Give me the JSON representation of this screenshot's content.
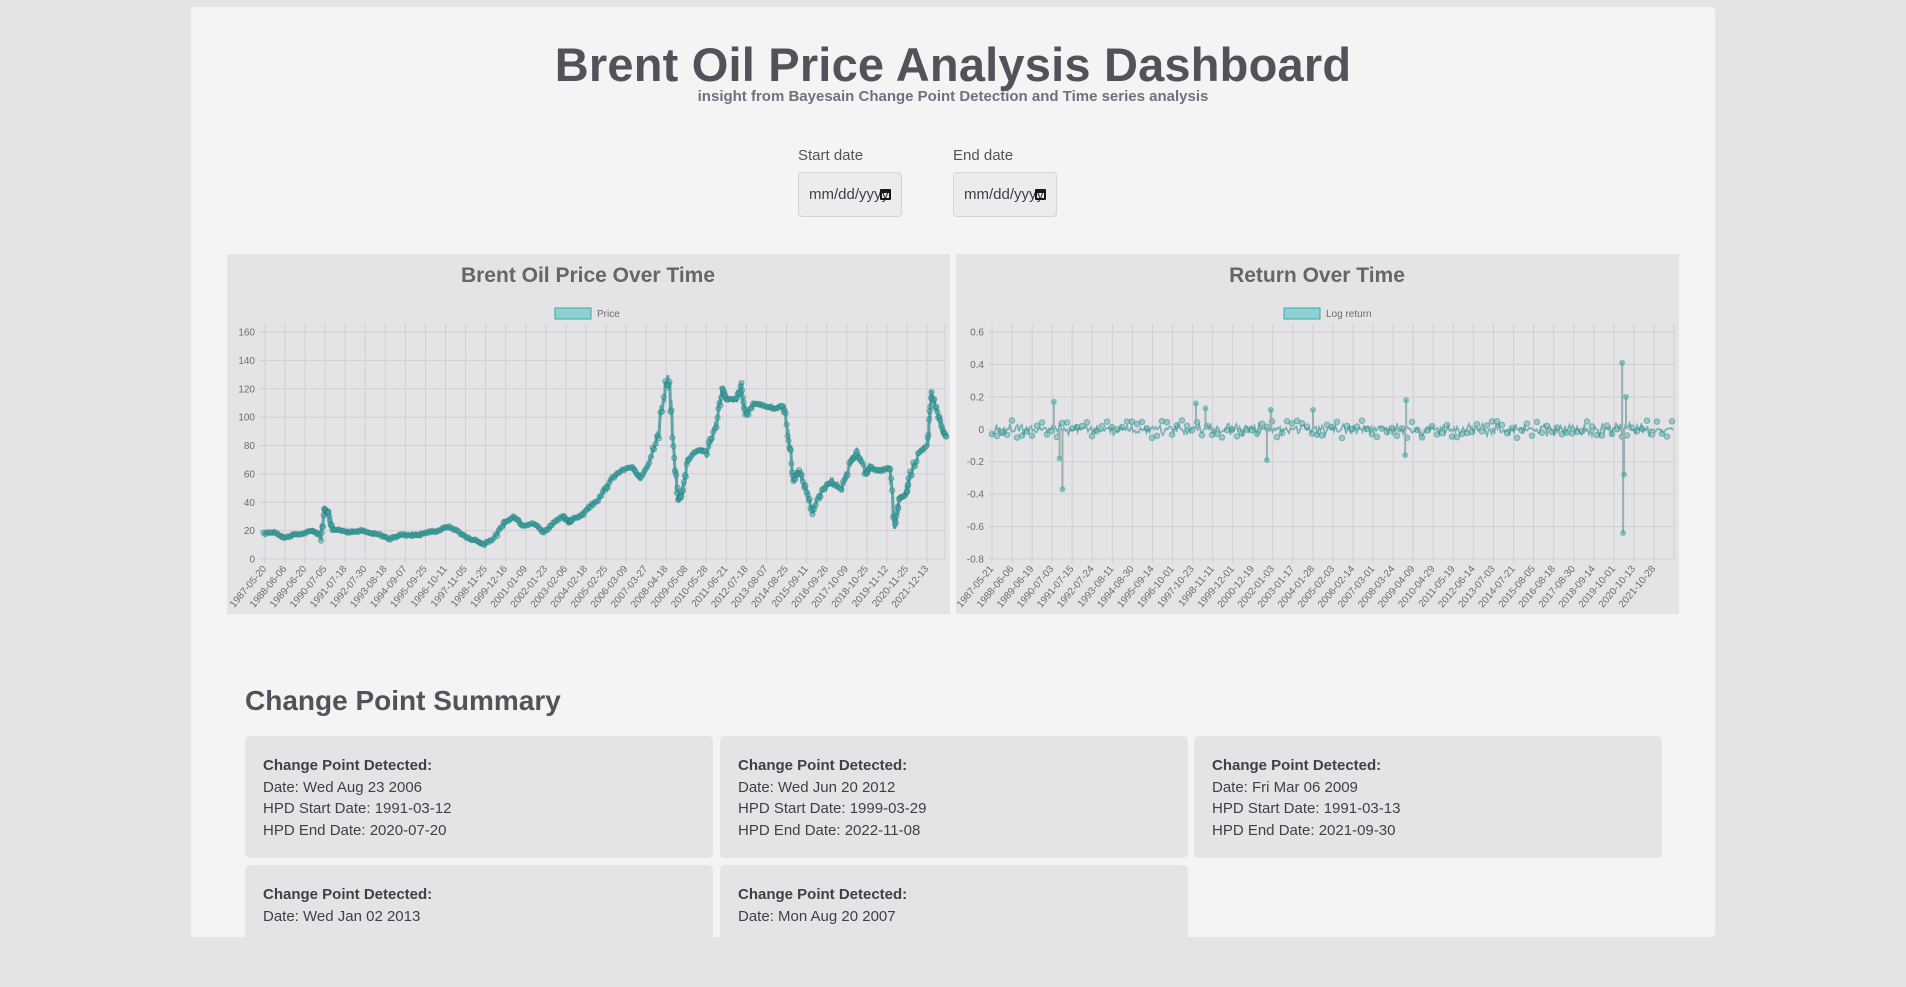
{
  "header": {
    "title": "Brent Oil Price Analysis Dashboard",
    "subtitle": "insight from Bayesain Change Point Detection and Time series analysis"
  },
  "filters": {
    "start_label": "Start date",
    "start_placeholder": "mm/dd/yyyy",
    "end_label": "End date",
    "end_placeholder": "mm/dd/yyyy"
  },
  "colors": {
    "accent": "#3aa9a9",
    "accent_fill": "#8fd0d0",
    "grid": "#cfcfd3",
    "axis_text": "#6b6b6b",
    "title_text": "#666666"
  },
  "chart_data": [
    {
      "type": "line",
      "title": "Brent Oil Price Over Time",
      "legend": [
        "Price"
      ],
      "legend_position": "top",
      "grid": true,
      "ylim": [
        0,
        160
      ],
      "yticks": [
        0,
        20,
        40,
        60,
        80,
        100,
        120,
        140,
        160
      ],
      "x_tick_labels": [
        "1987-05-20",
        "1988-06-06",
        "1989-06-20",
        "1990-07-05",
        "1991-07-18",
        "1992-07-30",
        "1993-08-18",
        "1994-09-07",
        "1995-09-25",
        "1996-10-11",
        "1997-11-05",
        "1998-11-25",
        "1999-12-16",
        "2001-01-09",
        "2002-01-23",
        "2003-02-06",
        "2004-02-18",
        "2005-02-25",
        "2006-03-09",
        "2007-03-27",
        "2008-04-18",
        "2009-05-08",
        "2010-05-28",
        "2011-06-21",
        "2012-07-18",
        "2013-08-07",
        "2014-08-25",
        "2015-09-11",
        "2016-09-26",
        "2017-10-09",
        "2018-10-25",
        "2019-11-12",
        "2020-11-25",
        "2021-12-13"
      ],
      "series": [
        {
          "name": "Price",
          "x": [
            1987.4,
            1988.0,
            1988.5,
            1989.0,
            1989.5,
            1990.0,
            1990.4,
            1990.6,
            1990.8,
            1991.0,
            1991.5,
            1992.0,
            1992.5,
            1993.0,
            1993.5,
            1994.0,
            1994.5,
            1995.0,
            1995.5,
            1996.0,
            1996.5,
            1997.0,
            1997.5,
            1998.0,
            1998.5,
            1998.9,
            1999.5,
            2000.0,
            2000.5,
            2000.9,
            2001.5,
            2002.0,
            2002.5,
            2003.0,
            2003.3,
            2003.5,
            2004.0,
            2004.5,
            2005.0,
            2005.5,
            2006.0,
            2006.6,
            2007.0,
            2007.5,
            2008.0,
            2008.5,
            2008.8,
            2009.0,
            2009.2,
            2009.5,
            2010.0,
            2010.5,
            2011.0,
            2011.3,
            2011.5,
            2012.0,
            2012.3,
            2012.5,
            2013.0,
            2013.5,
            2014.0,
            2014.5,
            2014.8,
            2015.0,
            2015.3,
            2015.7,
            2016.0,
            2016.5,
            2017.0,
            2017.5,
            2018.0,
            2018.3,
            2018.8,
            2019.0,
            2019.5,
            2020.0,
            2020.3,
            2020.5,
            2020.9,
            2021.0,
            2021.5,
            2022.0,
            2022.2,
            2022.5,
            2022.8,
            2023.0
          ],
          "y": [
            18,
            19,
            15,
            17,
            18,
            20,
            16,
            35,
            32,
            21,
            20,
            19,
            20,
            18,
            17,
            14,
            17,
            17,
            17,
            19,
            20,
            23,
            20,
            15,
            13,
            10,
            16,
            26,
            30,
            24,
            25,
            19,
            25,
            30,
            26,
            28,
            31,
            38,
            44,
            56,
            62,
            65,
            56,
            70,
            92,
            134,
            68,
            42,
            45,
            70,
            77,
            76,
            96,
            120,
            113,
            112,
            122,
            100,
            110,
            108,
            106,
            108,
            82,
            55,
            62,
            48,
            33,
            48,
            55,
            48,
            68,
            75,
            60,
            65,
            62,
            64,
            22,
            42,
            46,
            55,
            75,
            80,
            118,
            104,
            90,
            85
          ]
        }
      ]
    },
    {
      "type": "line",
      "title": "Return Over Time",
      "legend": [
        "Log return"
      ],
      "legend_position": "top",
      "grid": true,
      "ylim": [
        -0.8,
        0.6
      ],
      "yticks": [
        -0.8,
        -0.6,
        -0.4,
        -0.2,
        0,
        0.2,
        0.4,
        0.6
      ],
      "x_tick_labels": [
        "1987-05-21",
        "1988-06-06",
        "1989-06-19",
        "1990-07-03",
        "1991-07-15",
        "1992-07-24",
        "1993-08-11",
        "1994-08-30",
        "1995-09-14",
        "1996-10-01",
        "1997-10-23",
        "1998-11-11",
        "1999-12-01",
        "2000-12-19",
        "2002-01-03",
        "2003-01-17",
        "2004-01-28",
        "2005-02-03",
        "2006-02-14",
        "2007-03-01",
        "2008-03-24",
        "2009-04-09",
        "2010-04-29",
        "2011-05-19",
        "2012-06-14",
        "2013-07-03",
        "2014-07-21",
        "2015-08-05",
        "2016-08-18",
        "2017-08-30",
        "2018-09-14",
        "2019-10-01",
        "2020-10-13",
        "2021-10-28"
      ],
      "series": [
        {
          "name": "Log return",
          "spikes": [
            {
              "x": 1990.6,
              "y": 0.17
            },
            {
              "x": 1990.9,
              "y": -0.18
            },
            {
              "x": 1991.05,
              "y": -0.37
            },
            {
              "x": 1998.0,
              "y": 0.16
            },
            {
              "x": 1998.5,
              "y": 0.13
            },
            {
              "x": 2001.7,
              "y": -0.19
            },
            {
              "x": 2001.9,
              "y": 0.12
            },
            {
              "x": 2004.1,
              "y": 0.12
            },
            {
              "x": 2008.9,
              "y": -0.16
            },
            {
              "x": 2008.95,
              "y": 0.18
            },
            {
              "x": 2020.2,
              "y": 0.41
            },
            {
              "x": 2020.25,
              "y": -0.64
            },
            {
              "x": 2020.3,
              "y": -0.28
            },
            {
              "x": 2020.4,
              "y": 0.2
            }
          ]
        }
      ]
    }
  ],
  "summary": {
    "title": "Change Point Summary",
    "cards": [
      {
        "head": "Change Point Detected:",
        "date": "Date: Wed Aug 23 2006",
        "hpd_start": "HPD Start Date: 1991-03-12",
        "hpd_end": "HPD End Date: 2020-07-20"
      },
      {
        "head": "Change Point Detected:",
        "date": "Date: Wed Jun 20 2012",
        "hpd_start": "HPD Start Date: 1999-03-29",
        "hpd_end": "HPD End Date: 2022-11-08"
      },
      {
        "head": "Change Point Detected:",
        "date": "Date: Fri Mar 06 2009",
        "hpd_start": "HPD Start Date: 1991-03-13",
        "hpd_end": "HPD End Date: 2021-09-30"
      },
      {
        "head": "Change Point Detected:",
        "date": "Date: Wed Jan 02 2013",
        "hpd_start": "",
        "hpd_end": ""
      },
      {
        "head": "Change Point Detected:",
        "date": "Date: Mon Aug 20 2007",
        "hpd_start": "",
        "hpd_end": ""
      }
    ]
  }
}
